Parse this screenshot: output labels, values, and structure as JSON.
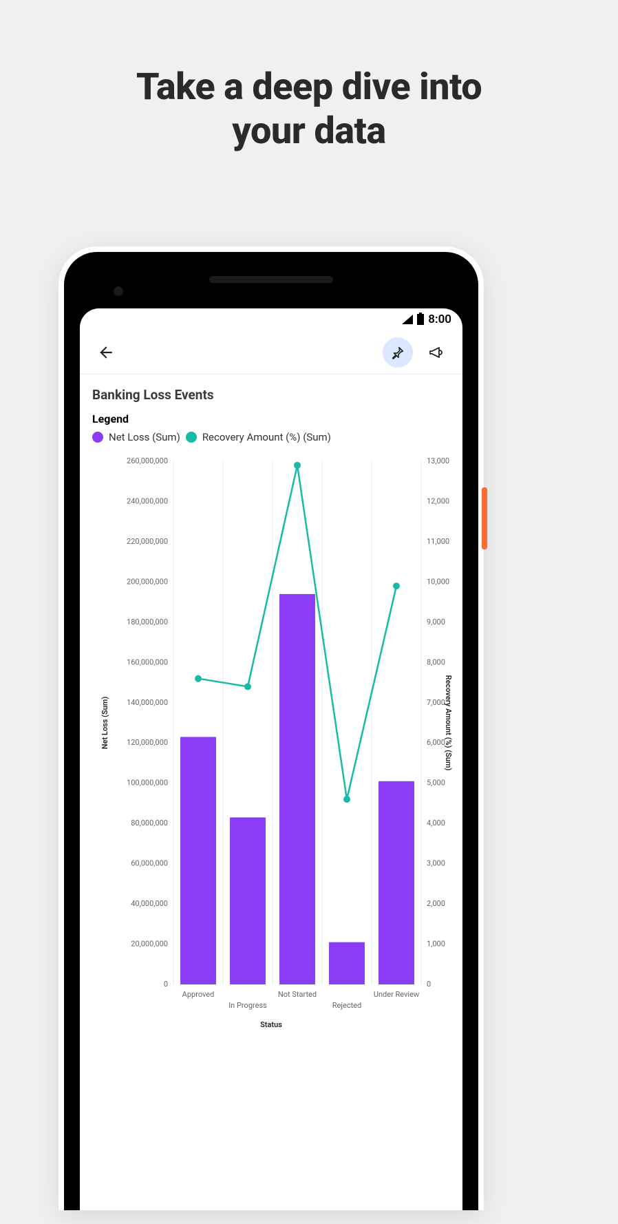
{
  "page": {
    "headline_line1": "Take a deep dive into",
    "headline_line2": "your data"
  },
  "statusbar": {
    "time": "8:00"
  },
  "app": {
    "chart_title": "Banking Loss Events",
    "legend_title": "Legend",
    "legend": {
      "series1": {
        "label": "Net Loss (Sum)",
        "color": "#8b3cf5"
      },
      "series2": {
        "label": "Recovery Amount (%) (Sum)",
        "color": "#17baa6"
      }
    }
  },
  "chart_data": {
    "type": "bar+line",
    "categories": [
      "Approved",
      "In Progress",
      "Not Started",
      "Rejected",
      "Under Review"
    ],
    "xlabel": "Status",
    "y1": {
      "label": "Net Loss (Sum)",
      "lim": [
        0,
        260000000
      ],
      "ticks": [
        0,
        20000000,
        40000000,
        60000000,
        80000000,
        100000000,
        120000000,
        140000000,
        160000000,
        180000000,
        200000000,
        220000000,
        240000000,
        260000000
      ],
      "tick_labels": [
        "0",
        "20,000,000",
        "40,000,000",
        "60,000,000",
        "80,000,000",
        "100,000,000",
        "120,000,000",
        "140,000,000",
        "160,000,000",
        "180,000,000",
        "200,000,000",
        "220,000,000",
        "240,000,000",
        "260,000,000"
      ]
    },
    "y2": {
      "label": "Recovery Amount (%) (Sum)",
      "lim": [
        0,
        13000
      ],
      "ticks": [
        0,
        1000,
        2000,
        3000,
        4000,
        5000,
        6000,
        7000,
        8000,
        9000,
        10000,
        11000,
        12000,
        13000
      ],
      "tick_labels": [
        "0",
        "1,000",
        "2,000",
        "3,000",
        "4,000",
        "5,000",
        "6,000",
        "7,000",
        "8,000",
        "9,000",
        "10,000",
        "11,000",
        "12,000",
        "13,000"
      ]
    },
    "series": [
      {
        "name": "Net Loss (Sum)",
        "type": "bar",
        "axis": "y1",
        "color": "#8b3cf5",
        "values": [
          123000000,
          83000000,
          194000000,
          21000000,
          101000000
        ]
      },
      {
        "name": "Recovery Amount (%) (Sum)",
        "type": "line",
        "axis": "y2",
        "color": "#17baa6",
        "values": [
          7600,
          7400,
          12900,
          4600,
          9900
        ]
      }
    ]
  }
}
